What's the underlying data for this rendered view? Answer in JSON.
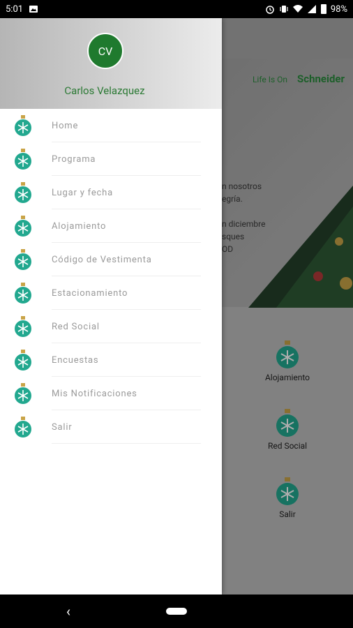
{
  "status_bar": {
    "time": "5:01",
    "battery": "98%"
  },
  "drawer": {
    "avatar_initials": "CV",
    "user_name": "Carlos Velazquez",
    "items": [
      {
        "label": "Home"
      },
      {
        "label": "Programa"
      },
      {
        "label": "Lugar y fecha"
      },
      {
        "label": "Alojamiento"
      },
      {
        "label": "Código de Vestimenta"
      },
      {
        "label": "Estacionamiento"
      },
      {
        "label": "Red Social"
      },
      {
        "label": "Encuestas"
      },
      {
        "label": "Mis Notificaciones"
      },
      {
        "label": "Salir"
      }
    ]
  },
  "background": {
    "brand_tag": "Life Is On",
    "brand_name": "Schneider",
    "banner_lines": [
      "n nosotros",
      "egría.",
      "",
      "n diciembre",
      "sques",
      "OD"
    ],
    "tiles": [
      {
        "label": "Alojamiento"
      },
      {
        "label": "Red Social"
      },
      {
        "label": "Salir"
      }
    ]
  },
  "colors": {
    "accent_green": "#1f7a2e",
    "ornament_teal": "#22a88f"
  }
}
